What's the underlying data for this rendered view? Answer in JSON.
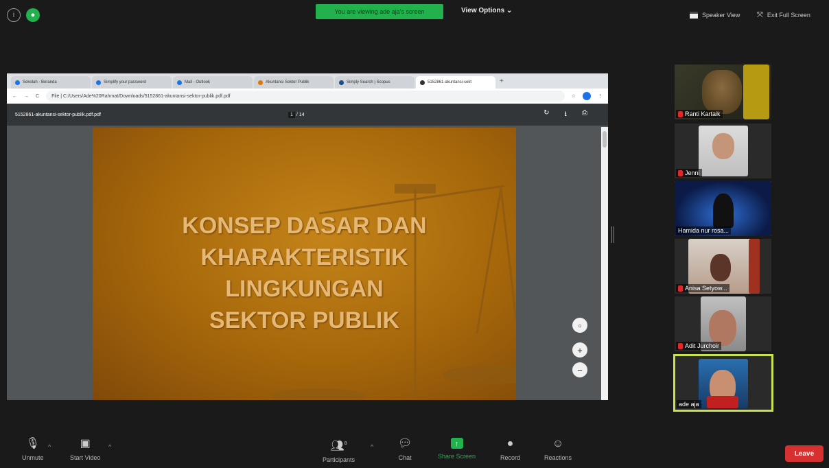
{
  "topbar": {
    "share_banner": "You are viewing ade aja's screen",
    "view_options": "View Options ⌄",
    "speaker_view": "Speaker View",
    "exit_fullscreen": "Exit Full Screen"
  },
  "browser": {
    "tabs": [
      {
        "label": "Sekolah - Beranda"
      },
      {
        "label": "Simplify your password"
      },
      {
        "label": "Mail - Outlook"
      },
      {
        "label": "Akuntansi Sektor Publik"
      },
      {
        "label": "Simply Search | Scopus"
      },
      {
        "label": "5152861-akuntansi-sekt"
      }
    ],
    "url": "File | C:/Users/Ade%20Rahmat/Downloads/5152861-akuntansi-sektor-publik.pdf.pdf"
  },
  "pdf": {
    "filename": "5152861-akuntansi-sektor-publik.pdf.pdf",
    "page_current": "1",
    "page_total": "/ 14"
  },
  "slide": {
    "line1": "KONSEP DASAR DAN",
    "line2": "KHARAKTERISTIK",
    "line3": "LINGKUNGAN",
    "line4": "SEKTOR  PUBLIK"
  },
  "participants": [
    {
      "name": "Ranti Kartaik",
      "muted": true
    },
    {
      "name": "Jenni",
      "muted": true
    },
    {
      "name": "Hamida nur rosa...",
      "muted": false
    },
    {
      "name": "Anisa Setyow...",
      "muted": true
    },
    {
      "name": "Adit Jurchoir",
      "muted": true
    },
    {
      "name": "ade aja",
      "muted": false
    }
  ],
  "toolbar": {
    "unmute": "Unmute",
    "start_video": "Start Video",
    "participants": "Participants",
    "participants_count": "8",
    "chat": "Chat",
    "share_screen": "Share Screen",
    "record": "Record",
    "reactions": "Reactions",
    "leave": "Leave"
  },
  "colors": {
    "share_green": "#23b14d",
    "leave_red": "#d73030",
    "active_border": "#c7e24a",
    "slide_brown": "#a5660a"
  }
}
